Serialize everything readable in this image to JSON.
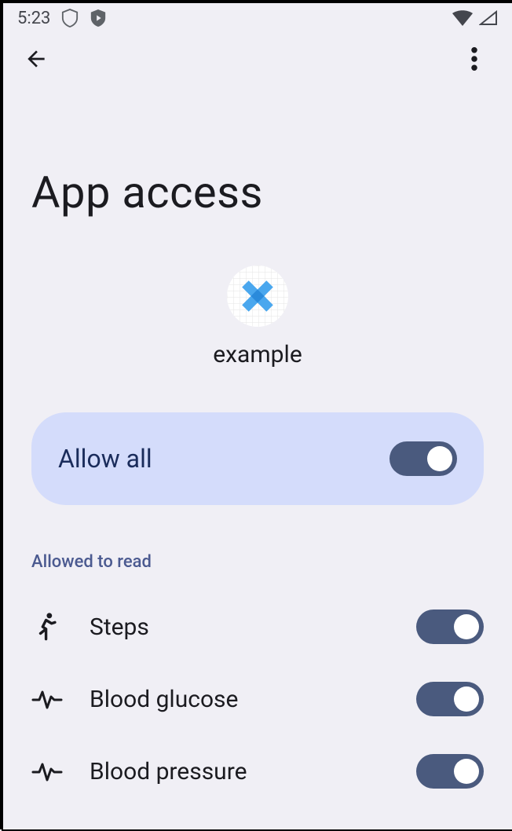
{
  "status_bar": {
    "time": "5:23"
  },
  "title": "App access",
  "app": {
    "name": "example"
  },
  "allow_all": {
    "label": "Allow all",
    "enabled": true
  },
  "section_header": "Allowed to read",
  "permissions": [
    {
      "id": "steps",
      "label": "Steps",
      "icon": "running-icon",
      "enabled": true
    },
    {
      "id": "blood-glucose",
      "label": "Blood glucose",
      "icon": "vitals-icon",
      "enabled": true
    },
    {
      "id": "blood-pressure",
      "label": "Blood pressure",
      "icon": "vitals-icon",
      "enabled": true
    }
  ]
}
